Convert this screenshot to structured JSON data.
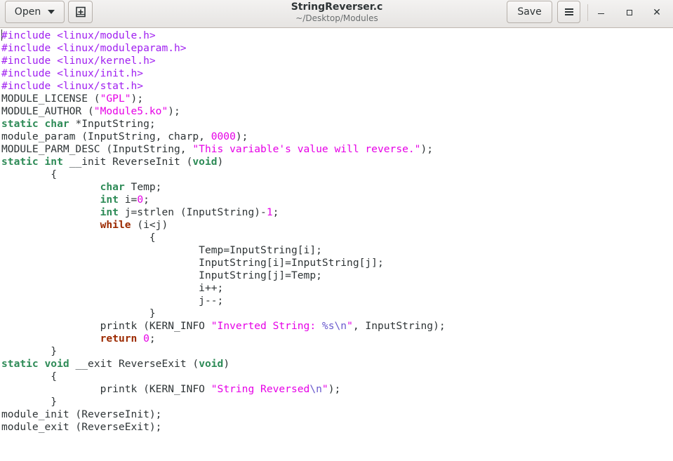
{
  "header": {
    "open_label": "Open",
    "save_label": "Save",
    "title": "StringReverser.c",
    "subtitle": "~/Desktop/Modules"
  },
  "icons": {
    "open_dropdown": "chevron-down-icon",
    "pin": "new-document-icon",
    "menu": "hamburger-menu-icon",
    "minimize": "minimize-icon",
    "maximize": "maximize-icon",
    "close": "close-icon"
  },
  "colors": {
    "preprocessor": "#a020f0",
    "string": "#e600e6",
    "number": "#e600e6",
    "escape": "#6a5acd",
    "keyword": "#9c2a00",
    "type": "#2e8b57",
    "text": "#2e3436"
  },
  "editor": {
    "lines": [
      [
        {
          "t": "#include <linux/module.h>",
          "c": "pp"
        }
      ],
      [
        {
          "t": "#include <linux/moduleparam.h>",
          "c": "pp"
        }
      ],
      [
        {
          "t": "#include <linux/kernel.h>",
          "c": "pp"
        }
      ],
      [
        {
          "t": "#include <linux/init.h>",
          "c": "pp"
        }
      ],
      [
        {
          "t": "#include <linux/stat.h>",
          "c": "pp"
        }
      ],
      [
        {
          "t": "MODULE_LICENSE (",
          "c": ""
        },
        {
          "t": "\"GPL\"",
          "c": "st"
        },
        {
          "t": ");",
          "c": ""
        }
      ],
      [
        {
          "t": "MODULE_AUTHOR (",
          "c": ""
        },
        {
          "t": "\"Module5.ko\"",
          "c": "st"
        },
        {
          "t": ");",
          "c": ""
        }
      ],
      [
        {
          "t": "static",
          "c": "ty"
        },
        {
          "t": " ",
          "c": ""
        },
        {
          "t": "char",
          "c": "ty"
        },
        {
          "t": " *InputString;",
          "c": ""
        }
      ],
      [
        {
          "t": "module_param (InputString, charp, ",
          "c": ""
        },
        {
          "t": "0000",
          "c": "num"
        },
        {
          "t": ");",
          "c": ""
        }
      ],
      [
        {
          "t": "MODULE_PARM_DESC (InputString, ",
          "c": ""
        },
        {
          "t": "\"This variable's value will reverse.\"",
          "c": "st"
        },
        {
          "t": ");",
          "c": ""
        }
      ],
      [
        {
          "t": "static",
          "c": "ty"
        },
        {
          "t": " ",
          "c": ""
        },
        {
          "t": "int",
          "c": "ty"
        },
        {
          "t": " __init ReverseInit (",
          "c": ""
        },
        {
          "t": "void",
          "c": "ty"
        },
        {
          "t": ")",
          "c": ""
        }
      ],
      [
        {
          "t": "\t{",
          "c": ""
        }
      ],
      [
        {
          "t": "\t\t",
          "c": ""
        },
        {
          "t": "char",
          "c": "ty"
        },
        {
          "t": " Temp;",
          "c": ""
        }
      ],
      [
        {
          "t": "\t\t",
          "c": ""
        },
        {
          "t": "int",
          "c": "ty"
        },
        {
          "t": " i=",
          "c": ""
        },
        {
          "t": "0",
          "c": "num"
        },
        {
          "t": ";",
          "c": ""
        }
      ],
      [
        {
          "t": "\t\t",
          "c": ""
        },
        {
          "t": "int",
          "c": "ty"
        },
        {
          "t": " j=strlen (InputString)-",
          "c": ""
        },
        {
          "t": "1",
          "c": "num"
        },
        {
          "t": ";",
          "c": ""
        }
      ],
      [
        {
          "t": "\t\t",
          "c": ""
        },
        {
          "t": "while",
          "c": "kw"
        },
        {
          "t": " (i<j)",
          "c": ""
        }
      ],
      [
        {
          "t": "\t\t\t{",
          "c": ""
        }
      ],
      [
        {
          "t": "\t\t\t\tTemp=InputString[i];",
          "c": ""
        }
      ],
      [
        {
          "t": "\t\t\t\tInputString[i]=InputString[j];",
          "c": ""
        }
      ],
      [
        {
          "t": "\t\t\t\tInputString[j]=Temp;",
          "c": ""
        }
      ],
      [
        {
          "t": "\t\t\t\ti++;",
          "c": ""
        }
      ],
      [
        {
          "t": "\t\t\t\tj--;",
          "c": ""
        }
      ],
      [
        {
          "t": "\t\t\t}",
          "c": ""
        }
      ],
      [
        {
          "t": "\t\tprintk (KERN_INFO ",
          "c": ""
        },
        {
          "t": "\"Inverted String: ",
          "c": "st"
        },
        {
          "t": "%s\\n",
          "c": "esc"
        },
        {
          "t": "\"",
          "c": "st"
        },
        {
          "t": ", InputString);",
          "c": ""
        }
      ],
      [
        {
          "t": "\t\t",
          "c": ""
        },
        {
          "t": "return",
          "c": "kw"
        },
        {
          "t": " ",
          "c": ""
        },
        {
          "t": "0",
          "c": "num"
        },
        {
          "t": ";",
          "c": ""
        }
      ],
      [
        {
          "t": "\t}",
          "c": ""
        }
      ],
      [
        {
          "t": "static",
          "c": "ty"
        },
        {
          "t": " ",
          "c": ""
        },
        {
          "t": "void",
          "c": "ty"
        },
        {
          "t": " __exit ReverseExit (",
          "c": ""
        },
        {
          "t": "void",
          "c": "ty"
        },
        {
          "t": ")",
          "c": ""
        }
      ],
      [
        {
          "t": "\t{",
          "c": ""
        }
      ],
      [
        {
          "t": "\t\tprintk (KERN_INFO ",
          "c": ""
        },
        {
          "t": "\"String Reversed",
          "c": "st"
        },
        {
          "t": "\\n",
          "c": "esc"
        },
        {
          "t": "\"",
          "c": "st"
        },
        {
          "t": ");",
          "c": ""
        }
      ],
      [
        {
          "t": "\t}",
          "c": ""
        }
      ],
      [
        {
          "t": "module_init (ReverseInit);",
          "c": ""
        }
      ],
      [
        {
          "t": "module_exit (ReverseExit);",
          "c": ""
        }
      ]
    ]
  }
}
